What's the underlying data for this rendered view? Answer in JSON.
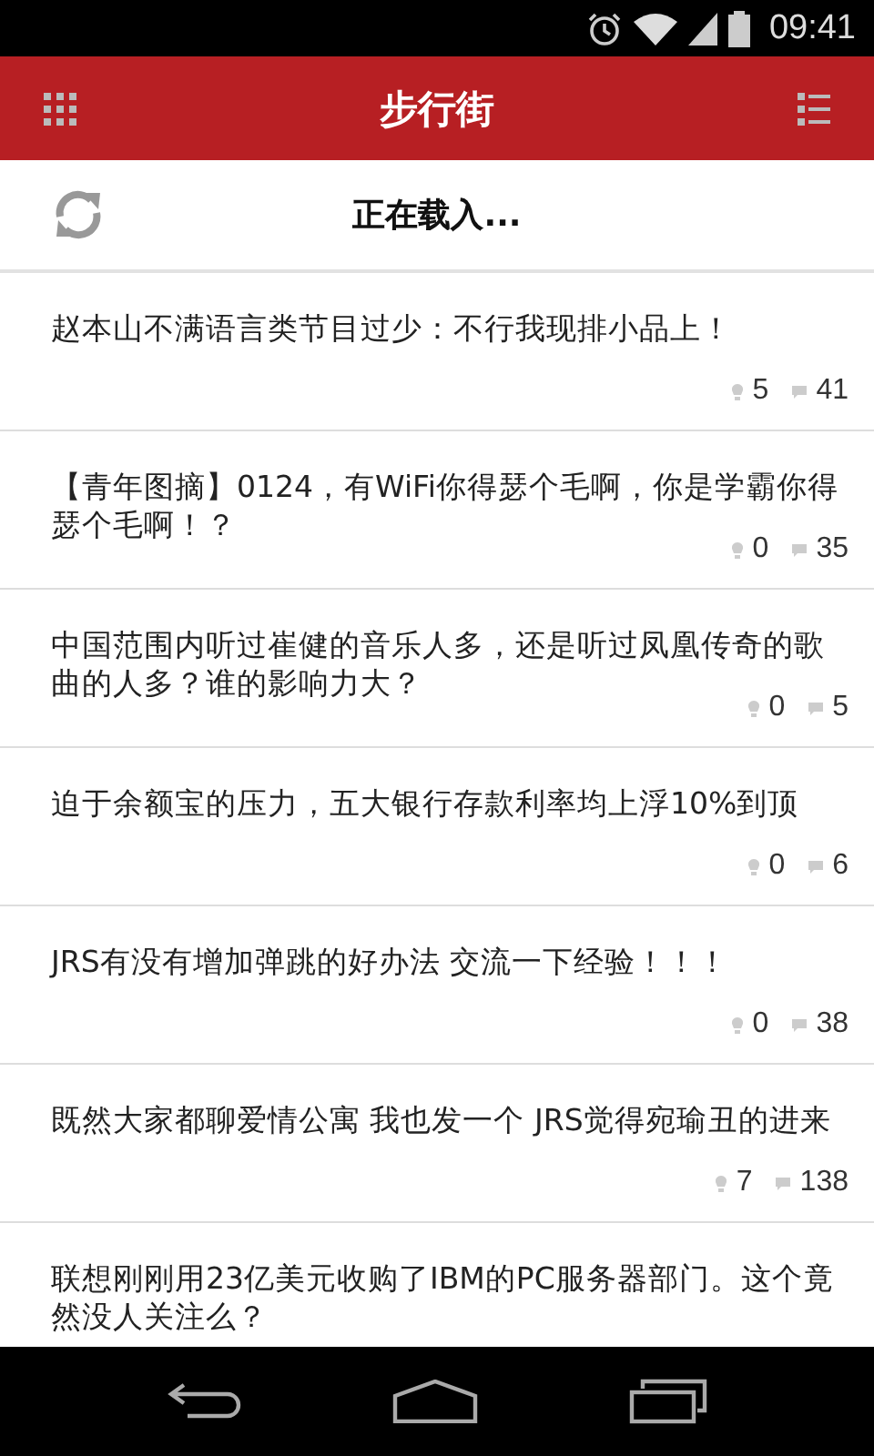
{
  "status_bar": {
    "time": "09:41"
  },
  "header": {
    "title": "步行街"
  },
  "loading": {
    "text": "正在载入..."
  },
  "posts": [
    {
      "title": "赵本山不满语言类节目过少：不行我现排小品上！",
      "likes": "5",
      "comments": "41"
    },
    {
      "title": "【青年图摘】0124，有WiFi你得瑟个毛啊，你是学霸你得瑟个毛啊！？",
      "likes": "0",
      "comments": "35"
    },
    {
      "title": "中国范围内听过崔健的音乐人多，还是听过凤凰传奇的歌曲的人多？谁的影响力大？",
      "likes": "0",
      "comments": "5"
    },
    {
      "title": "迫于余额宝的压力，五大银行存款利率均上浮10%到顶",
      "likes": "0",
      "comments": "6"
    },
    {
      "title": "JRS有没有增加弹跳的好办法 交流一下经验！！！",
      "likes": "0",
      "comments": "38"
    },
    {
      "title": "既然大家都聊爱情公寓 我也发一个 JRS觉得宛瑜丑的进来",
      "likes": "7",
      "comments": "138"
    },
    {
      "title": "联想刚刚用23亿美元收购了IBM的PC服务器部门。这个竟然没人关注么？"
    }
  ]
}
